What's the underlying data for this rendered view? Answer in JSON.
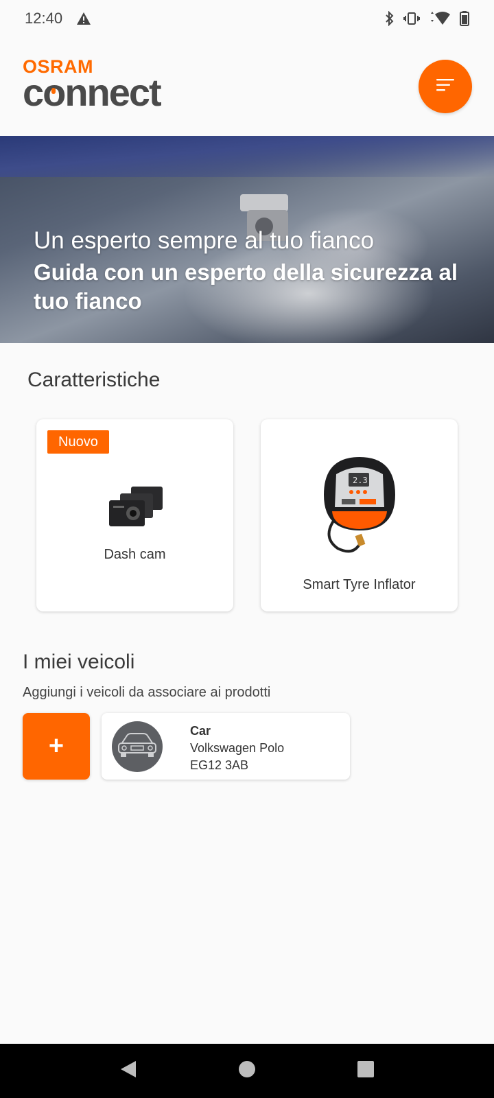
{
  "status_bar": {
    "time": "12:40",
    "icons": [
      "alert-icon",
      "bluetooth-icon",
      "vibrate-icon",
      "wifi-icon",
      "battery-icon"
    ]
  },
  "header": {
    "logo_brand": "OSRAM",
    "logo_word": "connect",
    "menu_icon": "menu-icon"
  },
  "hero": {
    "title": "Un esperto sempre al tuo fianco",
    "subtitle": "Guida con un esperto della sicurezza al tuo fianco"
  },
  "features": {
    "title": "Caratteristiche",
    "items": [
      {
        "label": "Dash cam",
        "badge": "Nuovo",
        "icon": "dash-cam-image"
      },
      {
        "label": "Smart Tyre Inflator",
        "icon": "tyre-inflator-image"
      }
    ]
  },
  "vehicles": {
    "title": "I miei veicoli",
    "subtitle": "Aggiungi i veicoli da associare ai prodotti",
    "add_label": "+",
    "items": [
      {
        "type": "Car",
        "model": "Volkswagen Polo",
        "plate": "EG12 3AB",
        "icon": "car-icon"
      }
    ]
  },
  "nav_bar": {
    "buttons": [
      "back-icon",
      "home-icon",
      "recents-icon"
    ]
  },
  "colors": {
    "accent": "#ff6600",
    "background": "#fafafa",
    "text": "#333333"
  }
}
